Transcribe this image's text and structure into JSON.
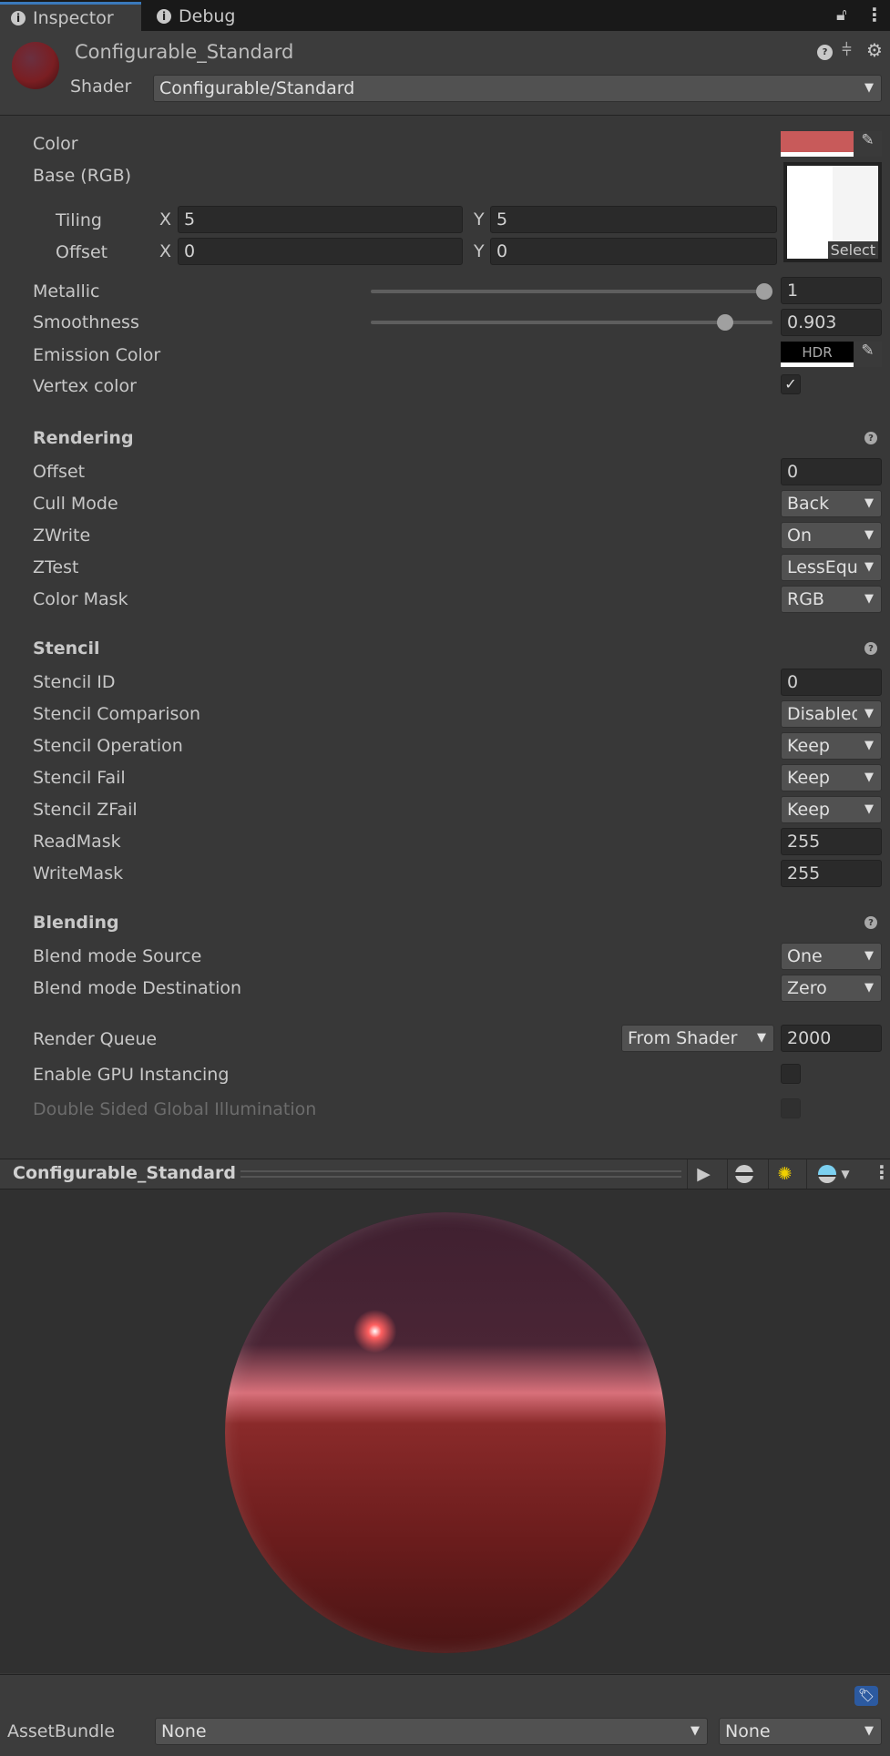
{
  "tabs": [
    {
      "label": "Inspector"
    },
    {
      "label": "Debug"
    }
  ],
  "header": {
    "title": "Configurable_Standard",
    "shader_label": "Shader",
    "shader_value": "Configurable/Standard"
  },
  "main": {
    "color_label": "Color",
    "color_value": "#c85a5a",
    "base_label": "Base (RGB)",
    "tiling_label": "Tiling",
    "offset_label": "Offset",
    "x": "X",
    "y": "Y",
    "tiling_x": "5",
    "tiling_y": "5",
    "offset_x": "0",
    "offset_y": "0",
    "select_label": "Select",
    "metallic_label": "Metallic",
    "metallic_value": "1",
    "metallic_fraction": 1,
    "smoothness_label": "Smoothness",
    "smoothness_value": "0.903",
    "smoothness_fraction": 0.903,
    "emission_label": "Emission Color",
    "hdr": "HDR",
    "vertex_label": "Vertex color",
    "vertex_checked": true
  },
  "rendering": {
    "title": "Rendering",
    "rows": [
      {
        "label": "Offset",
        "value": "0",
        "type": "field"
      },
      {
        "label": "Cull Mode",
        "value": "Back",
        "type": "dd"
      },
      {
        "label": "ZWrite",
        "value": "On",
        "type": "dd"
      },
      {
        "label": "ZTest",
        "value": "LessEqual",
        "type": "dd"
      },
      {
        "label": "Color Mask",
        "value": "RGB",
        "type": "dd"
      }
    ]
  },
  "stencil": {
    "title": "Stencil",
    "rows": [
      {
        "label": "Stencil ID",
        "value": "0",
        "type": "field"
      },
      {
        "label": "Stencil Comparison",
        "value": "Disabled",
        "type": "dd"
      },
      {
        "label": "Stencil Operation",
        "value": "Keep",
        "type": "dd"
      },
      {
        "label": "Stencil Fail",
        "value": "Keep",
        "type": "dd"
      },
      {
        "label": "Stencil ZFail",
        "value": "Keep",
        "type": "dd"
      },
      {
        "label": "ReadMask",
        "value": "255",
        "type": "field"
      },
      {
        "label": "WriteMask",
        "value": "255",
        "type": "field"
      }
    ]
  },
  "blending": {
    "title": "Blending",
    "rows": [
      {
        "label": "Blend mode Source",
        "value": "One",
        "type": "dd"
      },
      {
        "label": "Blend mode Destination",
        "value": "Zero",
        "type": "dd"
      }
    ]
  },
  "misc": {
    "render_queue_label": "Render Queue",
    "render_queue_mode": "From Shader",
    "render_queue_value": "2000",
    "gpu_label": "Enable GPU Instancing",
    "dsgi_label": "Double Sided Global Illumination"
  },
  "preview": {
    "title": "Configurable_Standard"
  },
  "footer": {
    "assetbundle_label": "AssetBundle",
    "bundle_value": "None",
    "variant_value": "None"
  }
}
